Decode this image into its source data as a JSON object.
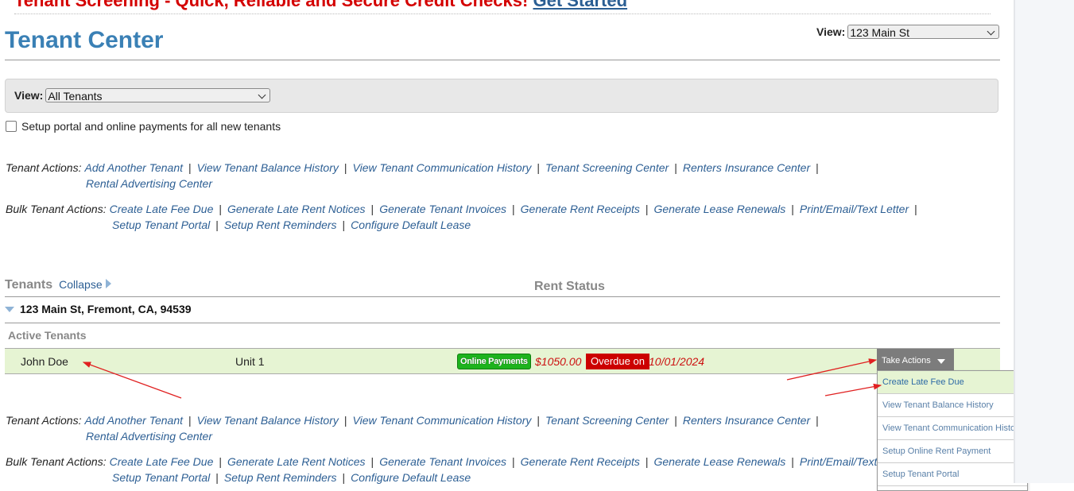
{
  "promo": {
    "text": "Tenant Screening - Quick, Reliable and Secure Credit Checks!",
    "link": "Get Started"
  },
  "header": {
    "title": "Tenant Center",
    "view_label": "View:",
    "view_value": "123 Main St"
  },
  "filter": {
    "view_label": "View:",
    "view_value": "All Tenants"
  },
  "setup_checkbox": {
    "label": "Setup portal and online payments for all new tenants",
    "checked": false
  },
  "tenant_actions": {
    "label": "Tenant Actions:",
    "links": [
      "Add Another Tenant",
      "View Tenant Balance History",
      "View Tenant Communication History",
      "Tenant Screening Center",
      "Renters Insurance Center",
      "Rental Advertising Center"
    ]
  },
  "bulk_actions": {
    "label": "Bulk Tenant Actions:",
    "links": [
      "Create Late Fee Due",
      "Generate Late Rent Notices",
      "Generate Tenant Invoices",
      "Generate Rent Receipts",
      "Generate Lease Renewals",
      "Print/Email/Text Letter",
      "Setup Tenant Portal",
      "Setup Rent Reminders",
      "Configure Default Lease"
    ]
  },
  "table": {
    "tenants_header": "Tenants",
    "collapse_label": "Collapse",
    "rent_status_header": "Rent Status",
    "property": "123 Main St, Fremont, CA, 94539",
    "group_label": "Active Tenants",
    "rows": [
      {
        "name": "John Doe",
        "unit": "Unit 1",
        "badge": "Online Payments",
        "amount": "$1050.00",
        "status": "Overdue on",
        "date": "10/01/2024",
        "action_button": "Take Actions"
      }
    ]
  },
  "take_actions_menu": {
    "items": [
      "Create Late Fee Due",
      "View Tenant Balance History",
      "View Tenant Communication History",
      "Setup Online Rent Payment",
      "Setup Tenant Portal"
    ],
    "highlighted": "Create Late Fee Due"
  },
  "colors": {
    "title_blue": "#3a80b5",
    "link_blue": "#2d5f94",
    "promo_red": "#d40000",
    "overdue_red": "#cc0000",
    "row_green": "#e6f4d3",
    "badge_green": "#1db31d",
    "annotation_arrow": "#e02020"
  }
}
